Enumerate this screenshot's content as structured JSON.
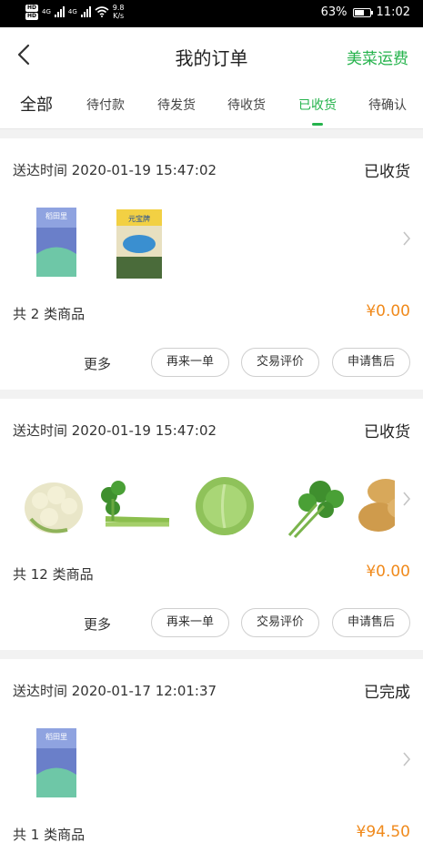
{
  "status_bar": {
    "hd1": "HD",
    "hd2": "HD",
    "net1": "4G",
    "net2": "4G",
    "speed_value": "9.8",
    "speed_unit": "K/s",
    "battery_percent": "63%",
    "battery_level": 0.63,
    "time": "11:02"
  },
  "header": {
    "title": "我的订单",
    "right_link": "美菜运费",
    "back_icon": "chevron-left-icon"
  },
  "tabs": [
    {
      "label": "全部"
    },
    {
      "label": "待付款"
    },
    {
      "label": "待发货"
    },
    {
      "label": "待收货"
    },
    {
      "label": "已收货",
      "active": true
    },
    {
      "label": "待确认"
    }
  ],
  "orders": [
    {
      "time": "送达时间 2020-01-19 15:47:02",
      "status": "已收货",
      "products": [
        {
          "icon": "rice-bag-icon",
          "label": "稻田里"
        },
        {
          "icon": "rice-bag-icon",
          "label": "元宝牌"
        }
      ],
      "count": "共 2 类商品",
      "price": "¥0.00",
      "more": "更多",
      "buttons": [
        "再来一单",
        "交易评价",
        "申请售后"
      ]
    },
    {
      "time": "送达时间 2020-01-19 15:47:02",
      "status": "已收货",
      "products": [
        {
          "icon": "cauliflower-icon"
        },
        {
          "icon": "celery-icon"
        },
        {
          "icon": "cabbage-icon"
        },
        {
          "icon": "cilantro-icon"
        },
        {
          "icon": "potato-icon"
        }
      ],
      "count": "共 12 类商品",
      "price": "¥0.00",
      "more": "更多",
      "buttons": [
        "再来一单",
        "交易评价",
        "申请售后"
      ]
    },
    {
      "time": "送达时间 2020-01-17 12:01:37",
      "status": "已完成",
      "products": [
        {
          "icon": "rice-bag-icon",
          "label": "稻田里"
        }
      ],
      "count": "共 1 类商品",
      "price": "¥94.50"
    }
  ],
  "colors": {
    "accent": "#25b34c",
    "price": "#f08a1c"
  }
}
